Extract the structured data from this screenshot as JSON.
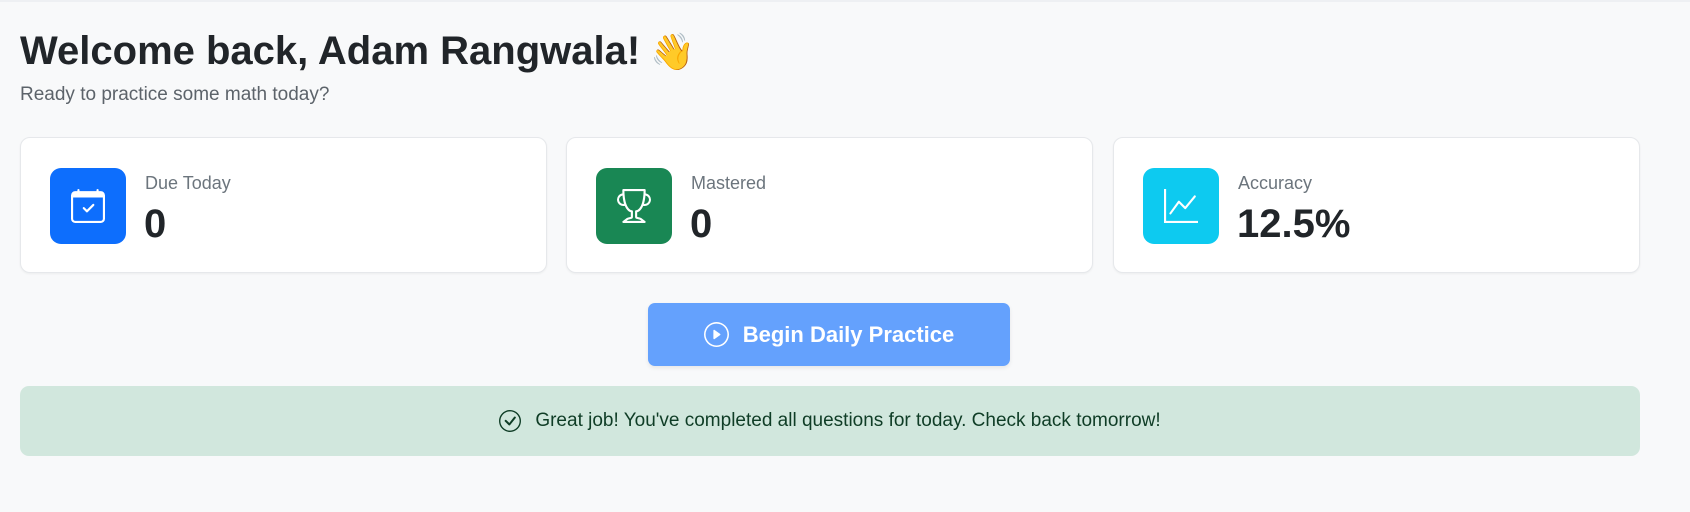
{
  "header": {
    "title": "Welcome back, Adam Rangwala!",
    "emoji": "👋",
    "subtitle": "Ready to practice some math today?"
  },
  "stats": [
    {
      "label": "Due Today",
      "value": "0",
      "icon": "calendar-check-icon",
      "color": "#0d6efd"
    },
    {
      "label": "Mastered",
      "value": "0",
      "icon": "trophy-icon",
      "color": "#198754"
    },
    {
      "label": "Accuracy",
      "value": "12.5%",
      "icon": "chart-line-icon",
      "color": "#0dcaf0"
    }
  ],
  "practice_button": {
    "label": "Begin Daily Practice",
    "icon": "play-circle-icon",
    "color": "#64a1fd"
  },
  "alert": {
    "message": "Great job! You've completed all questions for today. Check back tomorrow!",
    "icon": "check-circle-icon",
    "background": "#d1e7dd"
  }
}
